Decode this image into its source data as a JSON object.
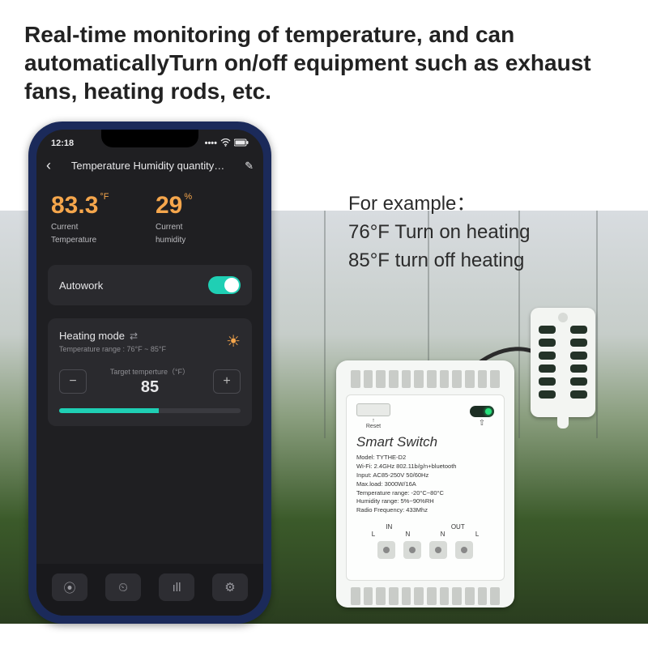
{
  "headline": "Real-time monitoring of temperature, and can automaticallyTurn on/off equipment such as exhaust fans, heating rods, etc.",
  "example": {
    "title": "For example：",
    "line1": "76°F   Turn on heating",
    "line2": "85°F   turn off  heating"
  },
  "status": {
    "time": "12:18",
    "signal": "●●●●",
    "wifi": "⋮",
    "battery": "▮"
  },
  "header": {
    "back": "‹",
    "title": "Temperature Humidity quantity…",
    "edit": "✎"
  },
  "readings": {
    "temp": {
      "value": "83.3",
      "unitTop": "°F",
      "label1": "Current",
      "label2": "Temperature"
    },
    "hum": {
      "value": "29",
      "unitTop": "%",
      "label1": "Current",
      "label2": "humidity"
    }
  },
  "autowork": {
    "label": "Autowork",
    "on": true
  },
  "mode": {
    "title": "Heating mode",
    "swap": "⇄",
    "sub": "Temperature range : 76°F ~ 85°F",
    "targetLabel": "Target temperture（°F）",
    "targetValue": "85",
    "minus": "−",
    "plus": "+"
  },
  "nav": {
    "a": "⦿",
    "b": "⏲",
    "c": "ıll",
    "d": "⚙"
  },
  "device": {
    "reset": "Reset",
    "wifi": "⇧",
    "brand": "Smart Switch",
    "specs": [
      "Model: TYTHE-D2",
      "Wi-Fi: 2.4GHz 802.11b/g/n+bluetooth",
      "Input: AC85-250V 50/60Hz",
      "Max.load: 3000W/16A",
      "Temperature range: -20°C~80°C",
      "Humidity range: 5%~90%RH",
      "Radio Frequency: 433Mhz"
    ],
    "in": "IN",
    "out": "OUT",
    "l": "L",
    "n": "N"
  }
}
